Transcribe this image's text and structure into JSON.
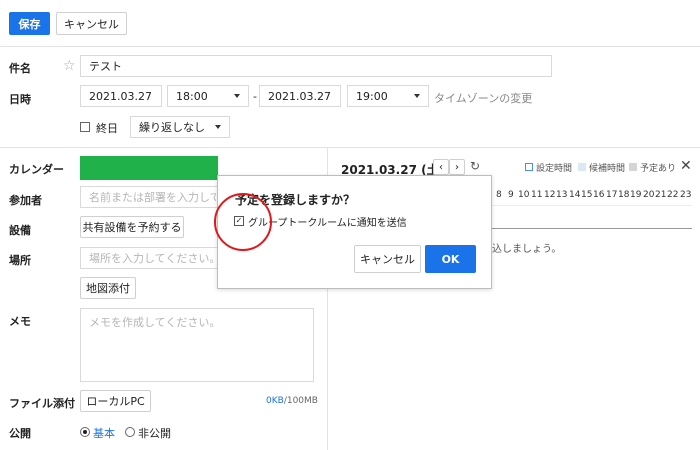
{
  "toolbar": {
    "save_label": "保存",
    "cancel_label": "キャンセル"
  },
  "form": {
    "subject": {
      "label": "件名",
      "value": "テスト"
    },
    "datetime": {
      "label": "日時",
      "start_date": "2021.03.27",
      "start_time": "18:00",
      "separator": "-",
      "end_date": "2021.03.27",
      "end_time": "19:00",
      "timezone_link": "タイムゾーンの変更",
      "all_day_label": "終日",
      "repeat_value": "繰り返しなし"
    },
    "calendar": {
      "label": "カレンダー",
      "color": "#21b14a"
    },
    "attendees": {
      "label": "参加者",
      "placeholder": "名前または部署を入力してく"
    },
    "equipment": {
      "label": "設備",
      "button_label": "共有設備を予約する"
    },
    "location": {
      "label": "場所",
      "placeholder": "場所を入力してください。",
      "map_button_label": "地図添付"
    },
    "memo": {
      "label": "メモ",
      "placeholder": "メモを作成してください。"
    },
    "attachment": {
      "label": "ファイル添付",
      "button_label": "ローカルPC",
      "size_used": "0KB",
      "size_limit": "/100MB"
    },
    "visibility": {
      "label": "公開",
      "options": [
        "基本",
        "非公開"
      ],
      "selected": "基本"
    }
  },
  "schedule_panel": {
    "date_label": "2021.03.27 (土)",
    "legend": [
      "設定時間",
      "候補時間",
      "予定あり"
    ],
    "hours": [
      "8",
      "9",
      "10",
      "11",
      "12",
      "13",
      "14",
      "15",
      "16",
      "17",
      "18",
      "19",
      "20",
      "21",
      "22",
      "23"
    ],
    "hint_fragment": "込しましょう。"
  },
  "dialog": {
    "title": "予定を登録しますか？",
    "checkbox_label": "グループトークルームに通知を送信",
    "cancel_label": "キャンセル",
    "ok_label": "OK"
  },
  "colors": {
    "accent": "#1a73e8",
    "calendar_green": "#21b14a",
    "highlight_circle": "#e0181b"
  }
}
